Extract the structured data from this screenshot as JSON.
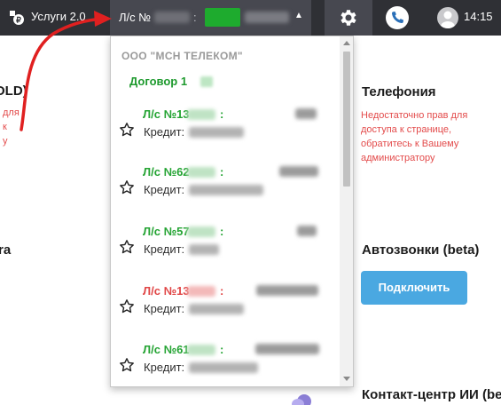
{
  "topbar": {
    "app_title": "Услуги 2.0",
    "account_label": "Л/с №",
    "account_colon": ":",
    "clock": "14:15",
    "accent_color": "#1eab2e"
  },
  "icons": {
    "logo": "ruble-logo-icon",
    "settings": "gear-icon",
    "phone": "phone-icon",
    "avatar": "user-avatar-icon",
    "caret": "caret-down-icon",
    "star": "star-outline-icon"
  },
  "background": {
    "partial_title_1": "OLD)",
    "partial_red_1": "для",
    "partial_red_2": "к",
    "partial_red_3": "у",
    "partial_title_2": "ra",
    "cards": [
      {
        "title": "Телефония",
        "note": "Недостаточно прав для доступа к странице, обратитесь к Вашему администратору"
      },
      {
        "title": "Автозвонки (beta)",
        "button": "Подключить"
      },
      {
        "title": "Контакт-центр ИИ (beta)"
      }
    ]
  },
  "dropdown": {
    "company": "ООО \"МСН ТЕЛЕКОМ\"",
    "contract_label": "Договор 1",
    "accounts": [
      {
        "label": "Л/с №13",
        "colon": ":",
        "credit_label": "Кредит:",
        "status": "green"
      },
      {
        "label": "Л/с №62",
        "colon": ":",
        "credit_label": "Кредит:",
        "status": "green"
      },
      {
        "label": "Л/с №57",
        "colon": ":",
        "credit_label": "Кредит:",
        "status": "green"
      },
      {
        "label": "Л/с №13",
        "colon": ":",
        "credit_label": "Кредит:",
        "status": "red"
      },
      {
        "label": "Л/с №61",
        "colon": ":",
        "credit_label": "Кредит:",
        "status": "green"
      }
    ]
  }
}
